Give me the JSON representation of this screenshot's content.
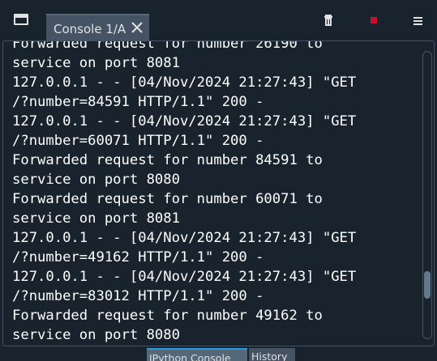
{
  "toolbar": {
    "tab_label": "Console 1/A",
    "icons": {
      "window": "window-icon",
      "close": "close-icon",
      "trash": "trash-icon",
      "stop": "stop-icon",
      "menu": "hamburger-menu-icon"
    },
    "stop_color": "#c8102e"
  },
  "console": {
    "lines": [
      "Forwarded request for number 26190 to",
      "service on port 8081",
      "127.0.0.1 - - [04/Nov/2024 21:27:43] \"GET",
      "/?number=84591 HTTP/1.1\" 200 -",
      "127.0.0.1 - - [04/Nov/2024 21:27:43] \"GET",
      "/?number=60071 HTTP/1.1\" 200 -",
      "Forwarded request for number 84591 to",
      "service on port 8080",
      "Forwarded request for number 60071 to",
      "service on port 8081",
      "127.0.0.1 - - [04/Nov/2024 21:27:43] \"GET",
      "/?number=49162 HTTP/1.1\" 200 -",
      "127.0.0.1 - - [04/Nov/2024 21:27:43] \"GET",
      "/?number=83012 HTTP/1.1\" 200 -",
      "Forwarded request for number 49162 to",
      "service on port 8080"
    ]
  },
  "bottom_tabs": {
    "ipython": "IPython Console",
    "history": "History"
  }
}
